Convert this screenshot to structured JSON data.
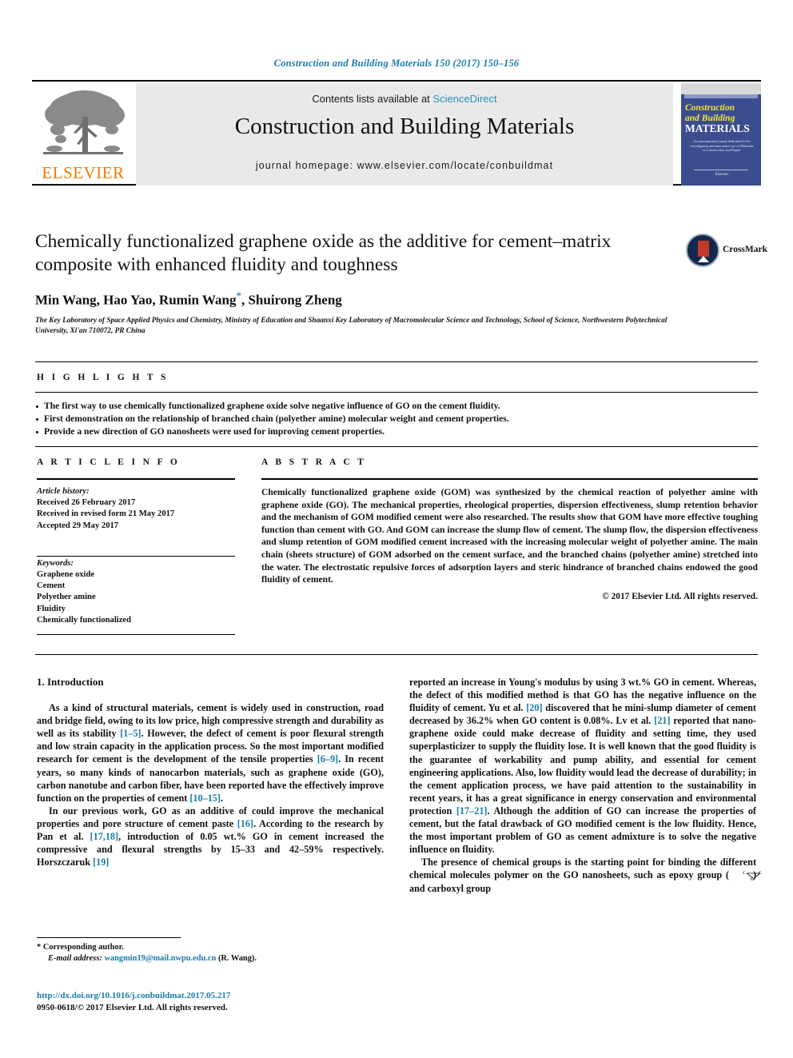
{
  "running_head": "Construction and Building Materials 150 (2017) 150–156",
  "masthead": {
    "contents_prefix": "Contents lists available at",
    "sciencedirect": "ScienceDirect",
    "journal_title": "Construction and Building Materials",
    "homepage": "journal homepage: www.elsevier.com/locate/conbuildmat",
    "publisher_logo_text": "ELSEVIER",
    "cover": {
      "line1": "Construction",
      "line2": "and Building",
      "line3": "MATERIALS",
      "subtitle": "An international journal dedicated to the investigation and innovative use of Materials in Construction and Repair",
      "footer": "Elsevier"
    }
  },
  "article": {
    "title": "Chemically functionalized graphene oxide as the additive for cement–matrix composite with enhanced fluidity and toughness",
    "authors": "Min Wang, Hao Yao, Rumin Wang",
    "authors_tail": ", Shuirong Zheng",
    "corresponding_marker": "*",
    "affiliation": "The Key Laboratory of Space Applied Physics and Chemistry, Ministry of Education and Shaanxi Key Laboratory of Macromolecular Science and Technology, School of Science, Northwestern Polytechnical University, Xi'an 710072, PR China",
    "crossmark_label": "CrossMark"
  },
  "highlights": {
    "heading": "H I G H L I G H T S",
    "items": [
      "The first way to use chemically functionalized graphene oxide solve negative influence of GO on the cement fluidity.",
      "First demonstration on the relationship of branched chain (polyether amine) molecular weight and cement properties.",
      "Provide a new direction of GO nanosheets were used for improving cement properties."
    ]
  },
  "article_info": {
    "heading": "A R T I C L E   I N F O",
    "history_label": "Article history:",
    "history": [
      "Received 26 February 2017",
      "Received in revised form 21 May 2017",
      "Accepted 29 May 2017"
    ],
    "keywords_label": "Keywords:",
    "keywords": [
      "Graphene oxide",
      "Cement",
      "Polyether amine",
      "Fluidity",
      "Chemically functionalized"
    ]
  },
  "abstract": {
    "heading": "A B S T R A C T",
    "text": "Chemically functionalized graphene oxide (GOM) was synthesized by the chemical reaction of polyether amine with graphene oxide (GO). The mechanical properties, rheological properties, dispersion effectiveness, slump retention behavior and the mechanism of GOM modified cement were also researched. The results show that GOM have more effective toughing function than cement with GO. And GOM can increase the slump flow of cement. The slump flow, the dispersion effectiveness and slump retention of GOM modified cement increased with the increasing molecular weight of polyether amine. The main chain (sheets structure) of GOM adsorbed on the cement surface, and the branched chains (polyether amine) stretched into the water. The electrostatic repulsive forces of adsorption layers and steric hindrance of branched chains endowed the good fluidity of cement.",
    "copyright": "© 2017 Elsevier Ltd. All rights reserved."
  },
  "body": {
    "section_title": "1. Introduction",
    "left": {
      "p1_a": "As a kind of structural materials, cement is widely used in construction, road and bridge field, owing to its low price, high compressive strength and durability as well as its stability ",
      "p1_ref1": "[1–5]",
      "p1_b": ". However, the defect of cement is poor flexural strength and low strain capacity in the application process. So the most important modified research for cement is the development of the tensile properties ",
      "p1_ref2": "[6–9]",
      "p1_c": ". In recent years, so many kinds of nanocarbon materials, such as graphene oxide (GO), carbon nanotube and carbon fiber, have been reported have the effectively improve function on the properties of cement ",
      "p1_ref3": "[10–15]",
      "p1_d": ".",
      "p2_a": "In our previous work, GO as an additive of could improve the mechanical properties and pore structure of cement paste ",
      "p2_ref1": "[16]",
      "p2_b": ". According to the research by Pan et al. ",
      "p2_ref2": "[17,18]",
      "p2_c": ", introduction of 0.05 wt.% GO in cement increased the compressive and flexural strengths by 15–33 and 42–59% respectively. Horszczaruk ",
      "p2_ref3": "[19]"
    },
    "right": {
      "p1_a": "reported an increase in Young's modulus by using 3 wt.% GO in cement. Whereas, the defect of this modified method is that GO has the negative influence on the fluidity of cement. Yu et al. ",
      "p1_ref1": "[20]",
      "p1_b": " discovered that he mini-slump diameter of cement decreased by 36.2% when GO content is 0.08%. Lv et al. ",
      "p1_ref2": "[21]",
      "p1_c": " reported that nano-graphene oxide could make decrease of fluidity and setting time, they used superplasticizer to supply the fluidity lose. It is well known that the good fluidity is the guarantee of workability and pump ability, and essential for cement engineering applications. Also, low fluidity would lead the decrease of durability; in the cement application process, we have paid attention to the sustainability in recent years, it has a great significance in energy conservation and environmental protection ",
      "p1_ref3": "[17–21]",
      "p1_d": ". Although the addition of GO can increase the properties of cement, but the fatal drawback of GO modified cement is the low fluidity. Hence, the most important problem of GO as cement admixture is to solve the negative influence on fluidity.",
      "p2_a": "The presence of chemical groups is the starting point for binding the different chemical molecules polymer on the GO nanosheets, such as epoxy group (",
      "p2_b": ") and carboxyl group"
    }
  },
  "footer": {
    "corresponding_marker": "*",
    "corresponding_text": "Corresponding author.",
    "email_label": "E-mail address:",
    "email": "wangmin19@mail.nwpu.edu.cn",
    "email_suffix": "(R. Wang).",
    "doi": "http://dx.doi.org/10.1016/j.conbuildmat.2017.05.217",
    "issn_line": "0950-0618/© 2017 Elsevier Ltd. All rights reserved."
  },
  "colors": {
    "link": "#1a7bab",
    "sciencedirect": "#2a8fc4",
    "elsevier_orange": "#f07c00",
    "cover_blue": "#3b4d8f"
  }
}
